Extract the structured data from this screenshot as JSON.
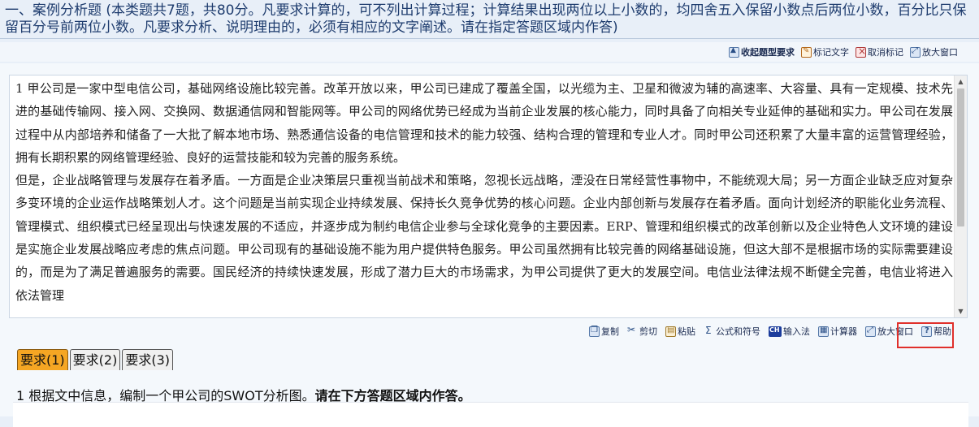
{
  "header": {
    "text": "一、案例分析题 (本类题共7题，共80分。凡要求计算的，可不列出计算过程；计算结果出现两位以上小数的，均四舍五入保留小数点后两位小数，百分比只保留百分号前两位小数。凡要求分析、说明理由的，必须有相应的文字阐述。请在指定答题区域内作答)"
  },
  "top_toolbar": {
    "collapse_label": "收起题型要求",
    "mark_label": "标记文字",
    "unmark_label": "取消标记",
    "enlarge_label": "放大窗口"
  },
  "document": {
    "text": "1 甲公司是一家中型电信公司，基础网络设施比较完善。改革开放以来，甲公司已建成了覆盖全国，以光缆为主、卫星和微波为辅的高速率、大容量、具有一定规模、技术先进的基础传输网、接入网、交换网、数据通信网和智能网等。甲公司的网络优势已经成为当前企业发展的核心能力，同时具备了向相关专业延伸的基础和实力。甲公司在发展过程中从内部培养和储备了一大批了解本地市场、熟悉通信设备的电信管理和技术的能力较强、结构合理的管理和专业人才。同时甲公司还积累了大量丰富的运营管理经验，拥有长期积累的网络管理经验、良好的运营技能和较为完善的服务系统。\n但是，企业战略管理与发展存在着矛盾。一方面是企业决策层只重视当前战术和策略，忽视长远战略，湮没在日常经营性事物中，不能统观大局；另一方面企业缺乏应对复杂多变环境的企业运作战略策划人才。这个问题是当前实现企业持续发展、保持长久竞争优势的核心问题。企业内部创新与发展存在着矛盾。面向计划经济的职能化业务流程、管理模式、组织模式已经呈现出与快速发展的不适应，并逐步成为制约电信企业参与全球化竞争的主要因素。ERP、管理和组织模式的改革创新以及企业特色人文环境的建设是实施企业发展战略应考虑的焦点问题。甲公司现有的基础设施不能为用户提供特色服务。甲公司虽然拥有比较完善的网络基础设施，但这大部不是根据市场的实际需要建设的，而是为了满足普遍服务的需要。国民经济的持续快速发展，形成了潜力巨大的市场需求，为甲公司提供了更大的发展空间。电信业法律法规不断健全完善，电信业将进入依法管理"
  },
  "bottom_toolbar": {
    "copy_label": "复制",
    "cut_label": "剪切",
    "paste_label": "粘贴",
    "formula_label": "公式和符号",
    "ime_label": "输入法",
    "calc_label": "计算器",
    "enlarge_label": "放大窗口",
    "help_label": "帮助"
  },
  "tabs": [
    {
      "label": "要求(1)",
      "active": true
    },
    {
      "label": "要求(2)",
      "active": false
    },
    {
      "label": "要求(3)",
      "active": false
    }
  ],
  "requirement": {
    "prefix": "1 根据文中信息，编制一个甲公司的SWOT分析图。",
    "emphasis": "请在下方答题区域内作答。"
  },
  "colors": {
    "active_tab": "#f5a623",
    "highlight_box": "#e0302b",
    "header_text": "#1e3c6e"
  }
}
